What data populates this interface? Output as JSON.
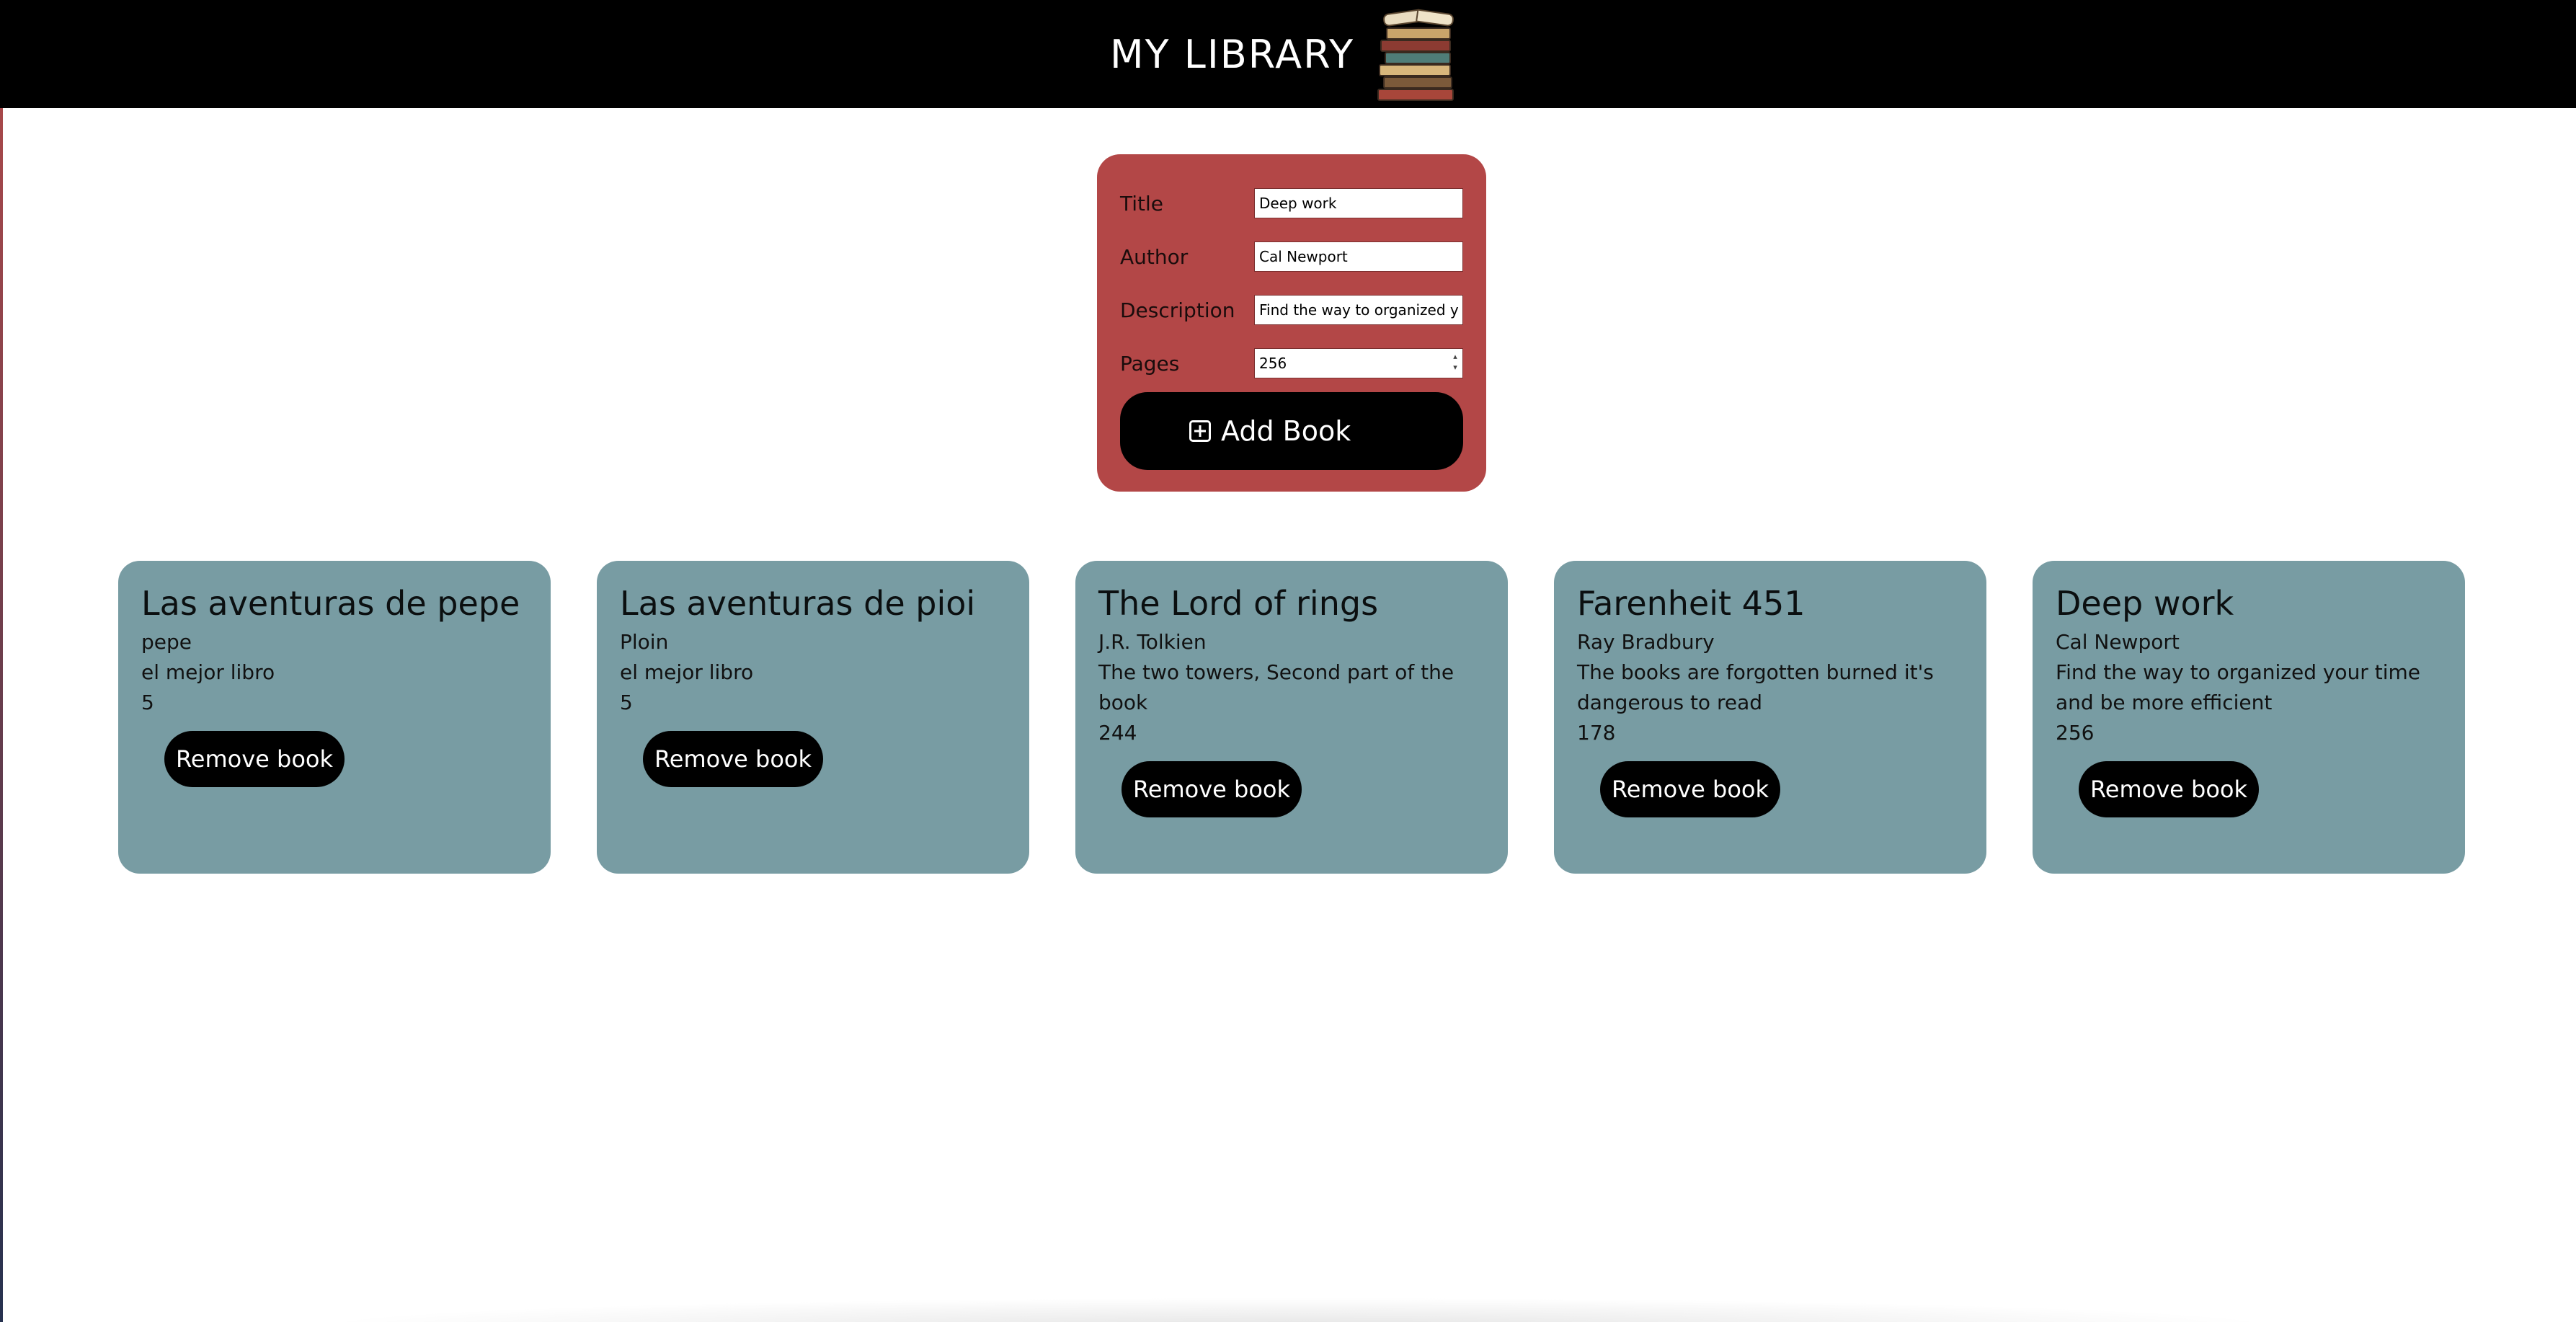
{
  "header": {
    "title": "MY LIBRARY",
    "logo_icon": "stack-of-books-icon"
  },
  "form": {
    "title_label": "Title",
    "title_value": "Deep work",
    "author_label": "Author",
    "author_value": "Cal Newport",
    "description_label": "Description",
    "description_value": "Find the way to organized y",
    "pages_label": "Pages",
    "pages_value": "256",
    "add_button_label": "Add Book",
    "add_icon": "plus-square-icon"
  },
  "books": [
    {
      "title": "Las aventuras de pepe",
      "author": "pepe",
      "description": "el mejor libro",
      "pages": "5",
      "remove_label": "Remove book"
    },
    {
      "title": "Las aventuras de pioi",
      "author": "Ploin",
      "description": "el mejor libro",
      "pages": "5",
      "remove_label": "Remove book"
    },
    {
      "title": "The Lord of rings",
      "author": "J.R. Tolkien",
      "description": "The two towers, Second part of the book",
      "pages": "244",
      "remove_label": "Remove book"
    },
    {
      "title": "Farenheit 451",
      "author": "Ray Bradbury",
      "description": "The books are forgotten burned it's dangerous to read",
      "pages": "178",
      "remove_label": "Remove book"
    },
    {
      "title": "Deep work",
      "author": "Cal Newport",
      "description": "Find the way to organized your time and be more efficient",
      "pages": "256",
      "remove_label": "Remove book"
    }
  ],
  "colors": {
    "header_bg": "#000000",
    "form_bg": "#b34747",
    "card_bg": "#789ca3",
    "button_bg": "#000000"
  }
}
